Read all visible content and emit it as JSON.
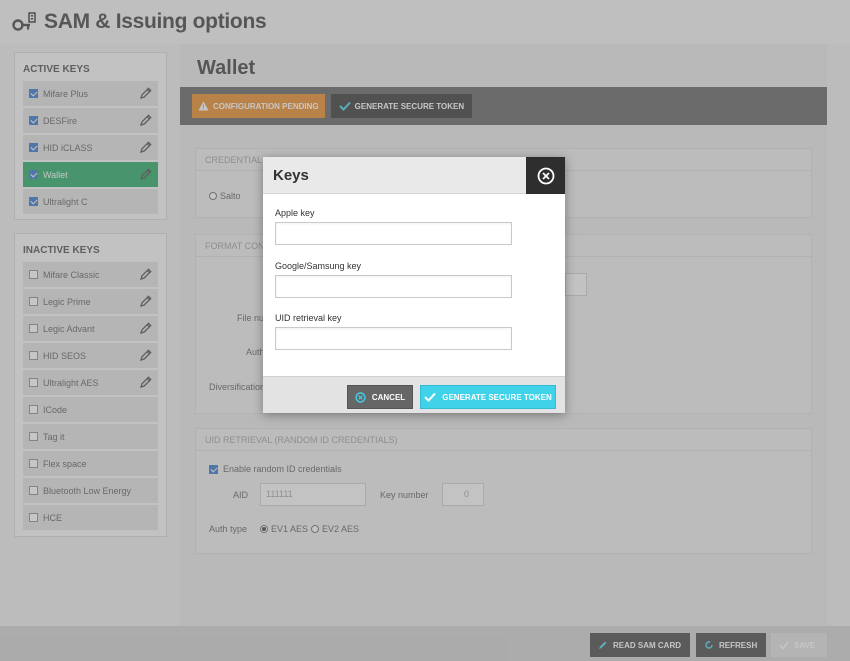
{
  "app": {
    "title": "SAM & Issuing options"
  },
  "sidebar": {
    "active_title": "ACTIVE KEYS",
    "active_items": [
      {
        "label": "Mifare Plus",
        "checked": true,
        "editable": true
      },
      {
        "label": "DESFire",
        "checked": true,
        "editable": true
      },
      {
        "label": "HID iCLASS",
        "checked": true,
        "editable": true
      },
      {
        "label": "Wallet",
        "checked": true,
        "editable": true,
        "selected": true
      },
      {
        "label": "Ultralight C",
        "checked": true,
        "editable": false
      }
    ],
    "inactive_title": "INACTIVE KEYS",
    "inactive_items": [
      {
        "label": "Mifare Classic",
        "checked": false,
        "editable": true
      },
      {
        "label": "Legic Prime",
        "checked": false,
        "editable": true
      },
      {
        "label": "Legic Advant",
        "checked": false,
        "editable": true
      },
      {
        "label": "HID SEOS",
        "checked": false,
        "editable": true
      },
      {
        "label": "Ultralight AES",
        "checked": false,
        "editable": true
      },
      {
        "label": "ICode",
        "checked": false,
        "editable": false
      },
      {
        "label": "Tag it",
        "checked": false,
        "editable": false
      },
      {
        "label": "Flex space",
        "checked": false,
        "editable": false
      },
      {
        "label": "Bluetooth Low Energy",
        "checked": false,
        "editable": false
      },
      {
        "label": "HCE",
        "checked": false,
        "editable": false
      }
    ]
  },
  "main": {
    "title": "Wallet",
    "toolbar": {
      "pending_label": "CONFIGURATION PENDING",
      "generate_label": "GENERATE SECURE TOKEN"
    },
    "credential_section": {
      "title": "CREDENTIAL",
      "radio_salto": "Salto"
    },
    "format_section": {
      "title": "FORMAT CON",
      "file_label": "File nu",
      "auth_label": "Auth",
      "diversification_label": "Diversification"
    },
    "uid_section": {
      "title": "UID RETRIEVAL (RANDOM ID CREDENTIALS)",
      "enable_label": "Enable random ID credentials",
      "aid_label": "AID",
      "aid_value": "111111",
      "key_number_label": "Key number",
      "key_number_value": "0",
      "auth_type_label": "Auth type",
      "auth_options": [
        "EV1 AES",
        "EV2 AES"
      ]
    }
  },
  "bottom": {
    "read_label": "READ SAM CARD",
    "refresh_label": "REFRESH",
    "save_label": "SAVE"
  },
  "modal": {
    "title": "Keys",
    "fields": [
      {
        "label": "Apple key",
        "value": ""
      },
      {
        "label": "Google/Samsung key",
        "value": ""
      },
      {
        "label": "UID retrieval key",
        "value": ""
      }
    ],
    "cancel_label": "CANCEL",
    "generate_label": "GENERATE SECURE TOKEN"
  },
  "colors": {
    "selected_key": "#1aa65e",
    "pending": "#e8841d",
    "generate_button": "#3fd2e8",
    "toolbar": "#5a5a5a"
  }
}
